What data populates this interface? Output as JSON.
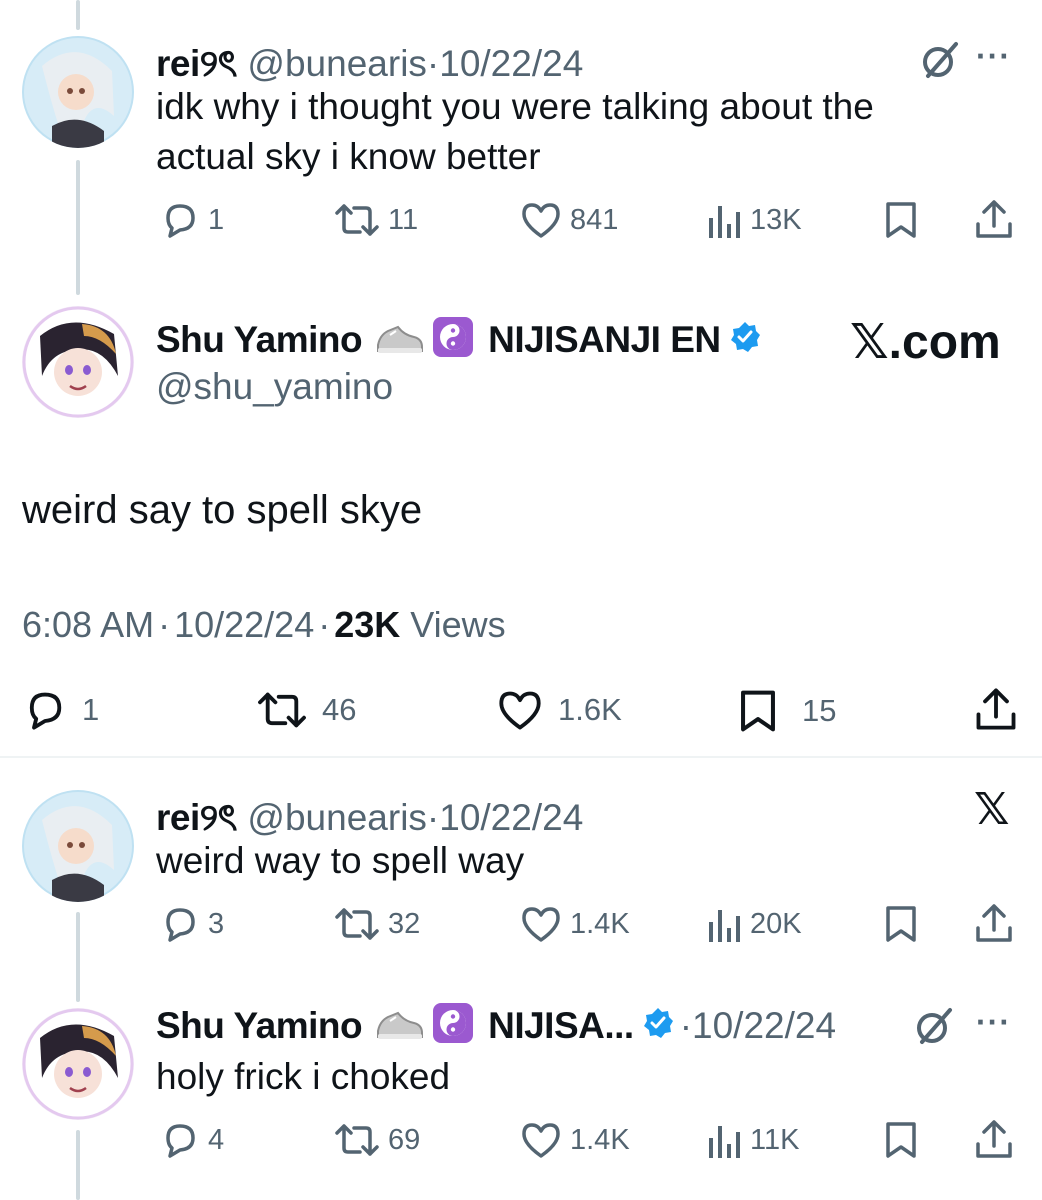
{
  "posts": [
    {
      "name": "rei୨ৎ",
      "handle": "@bunearis",
      "sep": "·",
      "date": "10/22/24",
      "text_line1": "idk why i thought you were talking about the",
      "text_line2": "actual sky i know better",
      "replies": "1",
      "reposts": "11",
      "likes": "841",
      "views": "13K"
    },
    {
      "name": "rei୨ৎ",
      "handle": "@bunearis",
      "sep": "·",
      "date": "10/22/24",
      "text_line1": "weird way to spell way",
      "replies": "3",
      "reposts": "32",
      "likes": "1.4K",
      "views": "20K"
    },
    {
      "name": "Shu Yamino",
      "org": "NIJISA...",
      "sep": "·",
      "date": "10/22/24",
      "text_line1": "holy frick i choked",
      "replies": "4",
      "reposts": "69",
      "likes": "1.4K",
      "views": "11K"
    }
  ],
  "main_post": {
    "name": "Shu Yamino",
    "org": "NIJISANJI EN",
    "handle": "@shu_yamino",
    "watermark": "𝕏.com",
    "text": "weird say to spell skye",
    "time": "6:08 AM",
    "sep": "·",
    "date": "10/22/24",
    "views_count": "23K",
    "views_label": "Views",
    "replies": "1",
    "reposts": "46",
    "likes": "1.6K",
    "bookmarks": "15"
  },
  "x_logo": "𝕏",
  "more_dots": "···",
  "colors": {
    "verified": "#1d9bf0",
    "grey": "#536471",
    "yinyang_bg": "#9b59d0"
  },
  "icons": [
    "reply-icon",
    "repost-icon",
    "like-icon",
    "views-icon",
    "bookmark-icon",
    "share-icon",
    "grok-icon",
    "more-icon",
    "x-logo-icon",
    "verified-icon",
    "sneaker-icon",
    "yin-yang-icon"
  ]
}
